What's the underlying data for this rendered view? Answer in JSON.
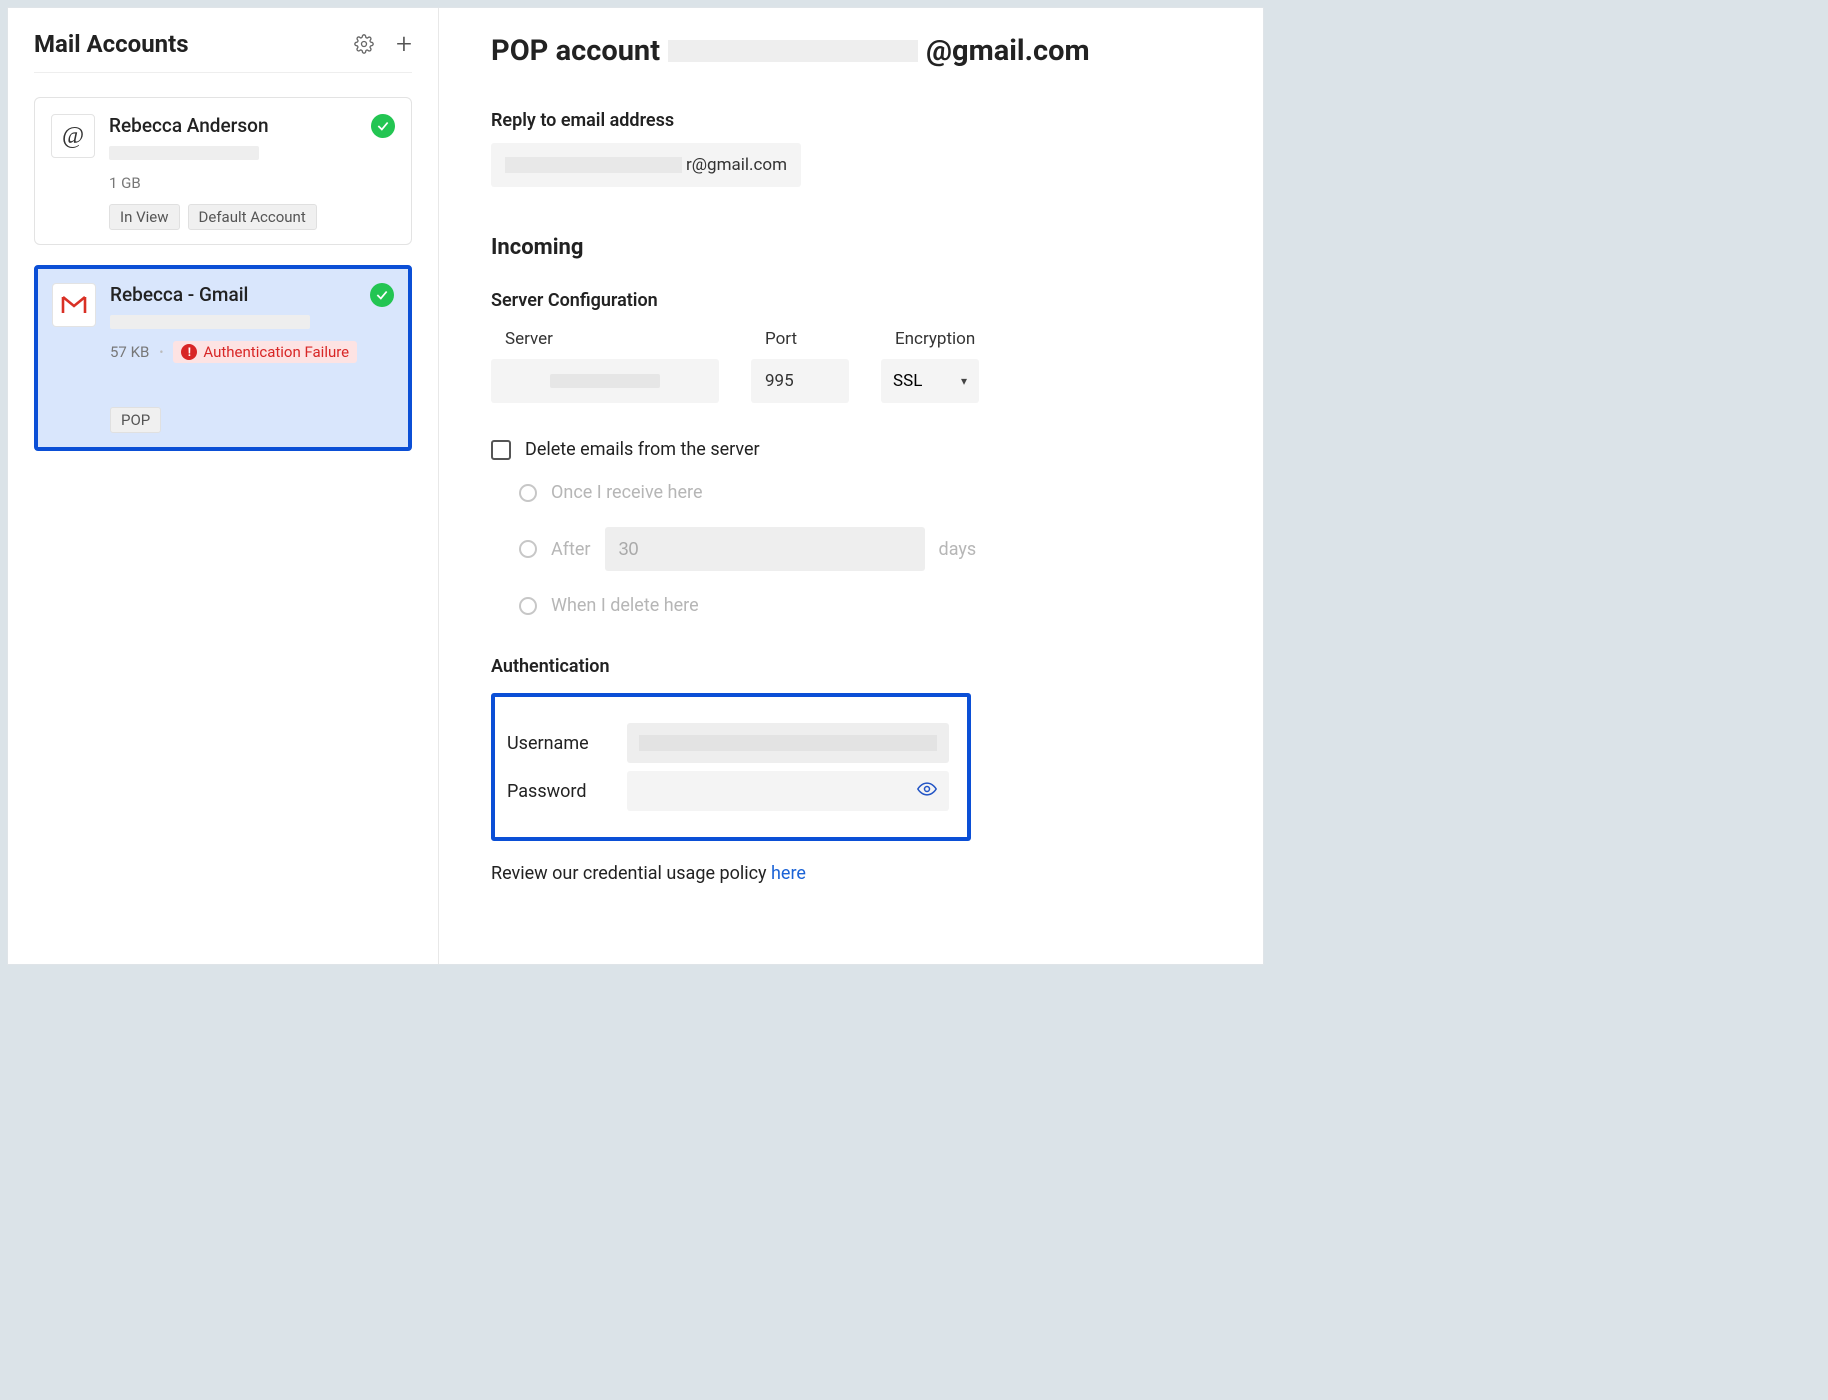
{
  "sidebar": {
    "title": "Mail Accounts",
    "accounts": [
      {
        "name": "Rebecca Anderson",
        "size": "1 GB",
        "tags": [
          "In View",
          "Default Account"
        ],
        "icon": "at",
        "status_ok": true
      },
      {
        "name": "Rebecca - Gmail",
        "size": "57 KB",
        "error": "Authentication Failure",
        "tags": [
          "POP"
        ],
        "icon": "gmail",
        "status_ok": true,
        "selected": true
      }
    ]
  },
  "main": {
    "title_prefix": "POP account",
    "title_suffix": "@gmail.com",
    "reply_label": "Reply to email address",
    "reply_suffix": "r@gmail.com",
    "incoming_heading": "Incoming",
    "server_config_heading": "Server Configuration",
    "server_label": "Server",
    "port_label": "Port",
    "port_value": "995",
    "encryption_label": "Encryption",
    "encryption_value": "SSL",
    "delete_label": "Delete emails from the server",
    "delete_options": {
      "once": "Once I receive here",
      "after_prefix": "After",
      "after_value": "30",
      "after_suffix": "days",
      "when_delete": "When I delete here"
    },
    "auth_heading": "Authentication",
    "username_label": "Username",
    "password_label": "Password",
    "policy_text": "Review our credential usage policy ",
    "policy_link": "here"
  }
}
